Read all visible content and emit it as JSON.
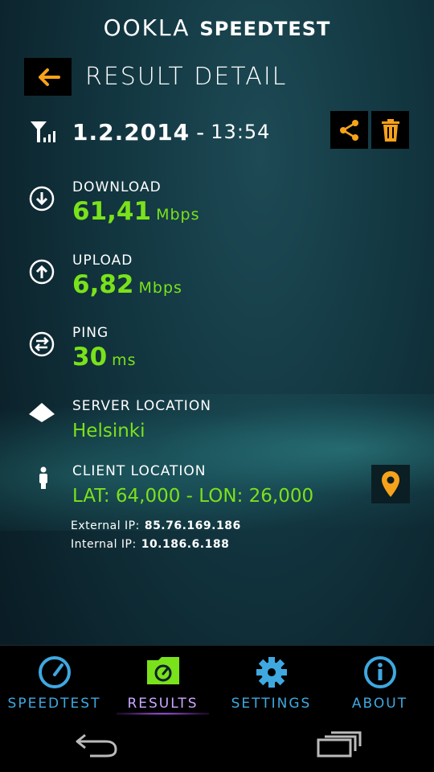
{
  "brand": {
    "left": "OOKLA",
    "right": "SPEEDTEST"
  },
  "header": {
    "title": "RESULT DETAIL"
  },
  "result": {
    "date": "1.2.2014",
    "separator": "-",
    "time": "13:54"
  },
  "download": {
    "label": "DOWNLOAD",
    "value": "61,41",
    "unit": "Mbps"
  },
  "upload": {
    "label": "UPLOAD",
    "value": "6,82",
    "unit": "Mbps"
  },
  "ping": {
    "label": "PING",
    "value": "30",
    "unit": "ms"
  },
  "server": {
    "label": "SERVER LOCATION",
    "value": "Helsinki"
  },
  "client": {
    "label": "CLIENT LOCATION",
    "value": "LAT: 64,000 - LON: 26,000"
  },
  "ips": {
    "external_label": "External IP:",
    "external_value": "85.76.169.186",
    "internal_label": "Internal IP:",
    "internal_value": "10.186.6.188"
  },
  "tabs": [
    {
      "label": "SPEEDTEST"
    },
    {
      "label": "RESULTS"
    },
    {
      "label": "SETTINGS"
    },
    {
      "label": "ABOUT"
    }
  ],
  "colors": {
    "accent_orange": "#f7a21b",
    "value_green": "#7ae21a",
    "tab_blue": "#3fa8e0",
    "active_green": "#7ae21a"
  },
  "icons": [
    "back-arrow-icon",
    "antenna-icon",
    "share-icon",
    "trash-icon",
    "download-icon",
    "upload-icon",
    "ping-icon",
    "server-icon",
    "client-icon",
    "map-pin-icon",
    "speedometer-icon",
    "results-folder-icon",
    "gear-icon",
    "info-icon",
    "nav-back-icon",
    "nav-recent-icon"
  ]
}
